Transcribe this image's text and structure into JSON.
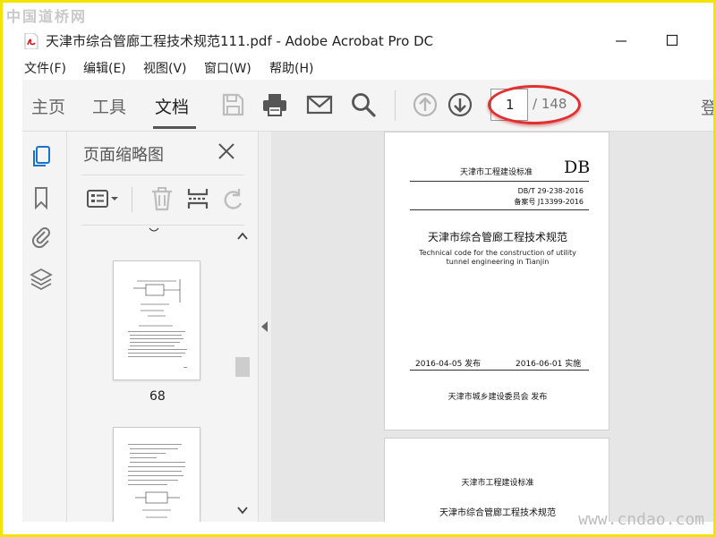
{
  "watermarks": {
    "top_left": "中国道桥网",
    "bottom_right": "www.cndao.com"
  },
  "window": {
    "title": "天津市综合管廊工程技术规范111.pdf - Adobe Acrobat Pro DC",
    "minimize_icon": "minimize-icon",
    "maximize_icon": "maximize-icon"
  },
  "menu": [
    {
      "label": "文件(F)"
    },
    {
      "label": "编辑(E)"
    },
    {
      "label": "视图(V)"
    },
    {
      "label": "窗口(W)"
    },
    {
      "label": "帮助(H)"
    }
  ],
  "toolbar": {
    "tabs": [
      {
        "label": "主页"
      },
      {
        "label": "工具"
      },
      {
        "label": "文档",
        "active": true
      }
    ],
    "icons": [
      "save-icon",
      "print-icon",
      "email-icon",
      "search-icon",
      "page-up-icon",
      "page-down-icon"
    ],
    "page_current": "1",
    "page_total": "/ 148",
    "right_cut": "登",
    "highlight_color": "#e03030"
  },
  "left_rail": {
    "icons": [
      "page-thumbnails-icon",
      "bookmark-icon",
      "attachment-icon",
      "layers-icon"
    ],
    "accent": "#1a73c9"
  },
  "thumb_panel": {
    "title": "页面缩略图",
    "tools": [
      "thumbnail-options-icon",
      "delete-icon",
      "extract-icon",
      "rotate-icon"
    ],
    "thumbnails": [
      {
        "label": "68"
      }
    ]
  },
  "document": {
    "page1": {
      "std_label": "天津市工程建设标准",
      "db": "DB",
      "code1": "DB/T 29-238-2016",
      "code2": "备案号 J13399-2016",
      "title_cn": "天津市综合管廊工程技术规范",
      "title_en_1": "Technical code for the construction of utility",
      "title_en_2": "tunnel engineering in Tianjin",
      "publish_date": "2016-04-05 发布",
      "implement_date": "2016-06-01  实施",
      "issuer": "天津市城乡建设委员会    发布"
    },
    "page2": {
      "std_label": "天津市工程建设标准",
      "title_cn": "天津市综合管廊工程技术规范"
    }
  }
}
